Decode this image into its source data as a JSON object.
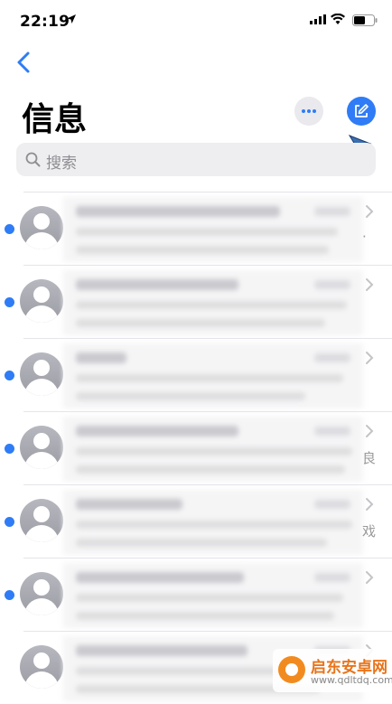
{
  "status_bar": {
    "time": "22:19"
  },
  "header": {
    "title": "信息"
  },
  "search": {
    "placeholder": "搜索"
  },
  "conversations": [
    {
      "unread": true,
      "edge_char": "·"
    },
    {
      "unread": true,
      "edge_char": ""
    },
    {
      "unread": true,
      "edge_char": ""
    },
    {
      "unread": true,
      "edge_char": "良"
    },
    {
      "unread": true,
      "edge_char": "戏"
    },
    {
      "unread": true,
      "edge_char": ""
    },
    {
      "unread": false,
      "edge_char": ""
    }
  ],
  "watermark": {
    "name": "启东安卓网",
    "url": "www.qdltdq.com"
  },
  "colors": {
    "accent": "#2f7cf6",
    "unread_dot": "#2f7cf6",
    "avatar": "#a3a4ab"
  }
}
